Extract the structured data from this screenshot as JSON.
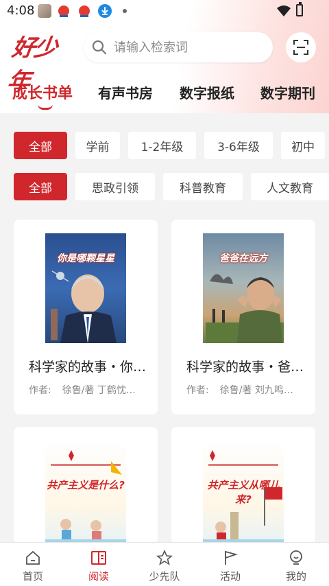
{
  "status_bar": {
    "time": "4:08"
  },
  "header": {
    "logo_text": "好少年",
    "search_placeholder": "请输入检索词"
  },
  "tabs": [
    {
      "label": "成长书单",
      "active": true
    },
    {
      "label": "有声书房",
      "active": false
    },
    {
      "label": "数字报纸",
      "active": false
    },
    {
      "label": "数字期刊",
      "active": false
    }
  ],
  "grade_filters": [
    {
      "label": "全部",
      "active": true
    },
    {
      "label": "学前",
      "active": false
    },
    {
      "label": "1-2年级",
      "active": false
    },
    {
      "label": "3-6年级",
      "active": false
    },
    {
      "label": "初中",
      "active": false
    }
  ],
  "topic_filters": [
    {
      "label": "全部",
      "active": true
    },
    {
      "label": "思政引领",
      "active": false
    },
    {
      "label": "科普教育",
      "active": false
    },
    {
      "label": "人文教育",
      "active": false
    }
  ],
  "books": [
    {
      "cover_title": "你是哪颗星星",
      "title": "科学家的故事・你…",
      "author_label": "作者:",
      "authors": "徐鲁/著 丁鹤忱…"
    },
    {
      "cover_title": "爸爸在远方",
      "title": "科学家的故事・爸…",
      "author_label": "作者:",
      "authors": "徐鲁/著 刘九鸣…"
    },
    {
      "cover_title": "共产主义是什么?",
      "title": "",
      "author_label": "",
      "authors": ""
    },
    {
      "cover_title": "共产主义从哪儿来?",
      "title": "",
      "author_label": "",
      "authors": ""
    }
  ],
  "bottom_nav": [
    {
      "label": "首页",
      "icon": "home-icon",
      "active": false
    },
    {
      "label": "阅读",
      "icon": "book-icon",
      "active": true
    },
    {
      "label": "少先队",
      "icon": "star-icon",
      "active": false
    },
    {
      "label": "活动",
      "icon": "flag-icon",
      "active": false
    },
    {
      "label": "我的",
      "icon": "user-icon",
      "active": false
    }
  ],
  "colors": {
    "accent": "#d0272d",
    "background": "#f3f3f3"
  }
}
